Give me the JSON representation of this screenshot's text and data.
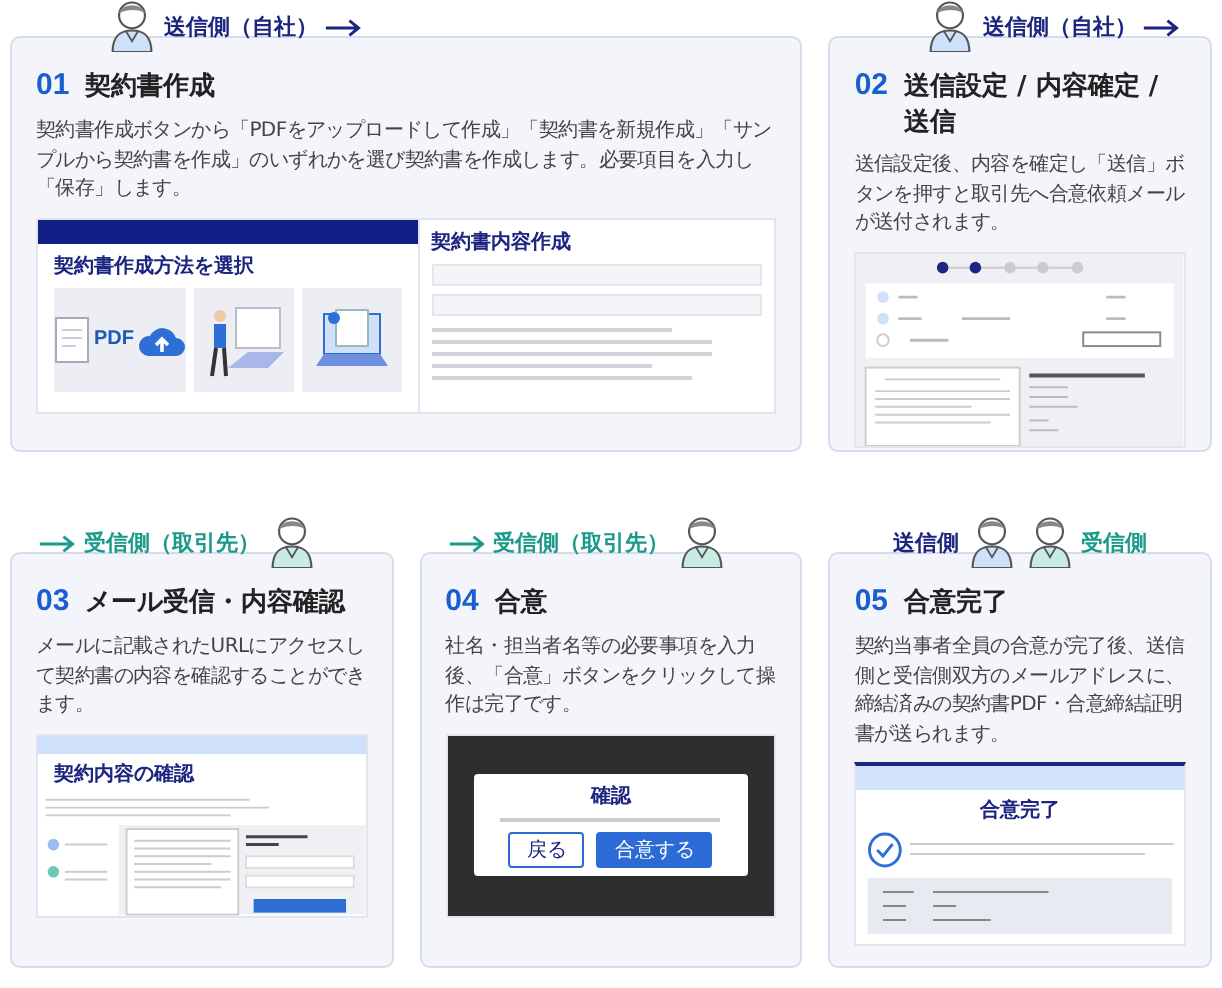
{
  "rows": [
    [
      {
        "number": "01",
        "title": "契約書作成",
        "description": "契約書作成ボタンから「PDFをアップロードして作成」「契約書を新規作成」「サンプルから契約書を作成」のいずれかを選び契約書を作成します。必要項目を入力し「保存」します。",
        "side": {
          "kind": "sender",
          "label": "送信側（自社）"
        },
        "screen": {
          "kind": "create",
          "texts": [
            "契約書作成方法を選択",
            "PDF",
            "契約書内容作成"
          ]
        }
      },
      {
        "number": "02",
        "title": "送信設定 / 内容確定 / 送信",
        "description": "送信設定後、内容を確定し「送信」ボタンを押すと取引先へ合意依頼メールが送付されます。",
        "side": {
          "kind": "sender",
          "label": "送信側（自社）"
        },
        "screen": {
          "kind": "send"
        }
      }
    ],
    [
      {
        "number": "03",
        "title": "メール受信・内容確認",
        "description": "メールに記載されたURLにアクセスして契約書の内容を確認することができます。",
        "side": {
          "kind": "receiver",
          "label": "受信側（取引先）"
        },
        "screen": {
          "kind": "review",
          "texts": [
            "契約内容の確認"
          ]
        }
      },
      {
        "number": "04",
        "title": "合意",
        "description": "社名・担当者名等の必要事項を入力後、「合意」ボタンをクリックして操作は完了です。",
        "side": {
          "kind": "receiver",
          "label": "受信側（取引先）"
        },
        "screen": {
          "kind": "agree",
          "texts": [
            "確認",
            "戻る",
            "合意する"
          ]
        }
      },
      {
        "number": "05",
        "title": "合意完了",
        "description": "契約当事者全員の合意が完了後、送信側と受信側双方のメールアドレスに、締結済みの契約書PDF・合意締結証明書が送られます。",
        "side": {
          "kind": "both",
          "label": "送信側",
          "label_2": "受信側"
        },
        "screen": {
          "kind": "done",
          "texts": [
            "合意完了"
          ]
        }
      }
    ]
  ]
}
